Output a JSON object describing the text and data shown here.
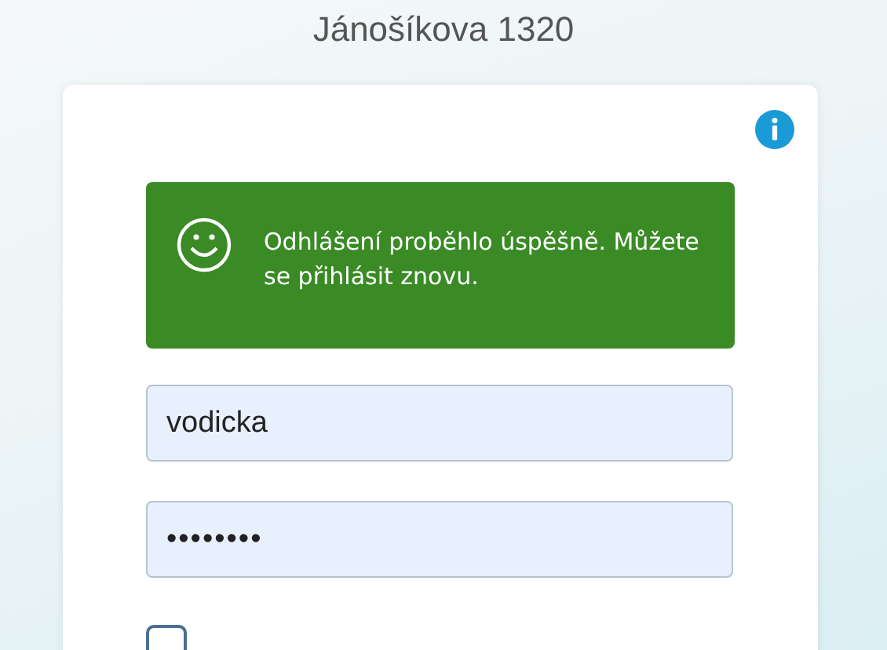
{
  "page_title": "Jánošíkova 1320",
  "message": {
    "kind": "success",
    "text": "Odhlášení proběhlo úspěšně. Můžete se přihlásit znovu."
  },
  "username": {
    "value": "vodicka"
  },
  "password": {
    "value": "••••••••"
  },
  "remember": {
    "checked": false
  }
}
